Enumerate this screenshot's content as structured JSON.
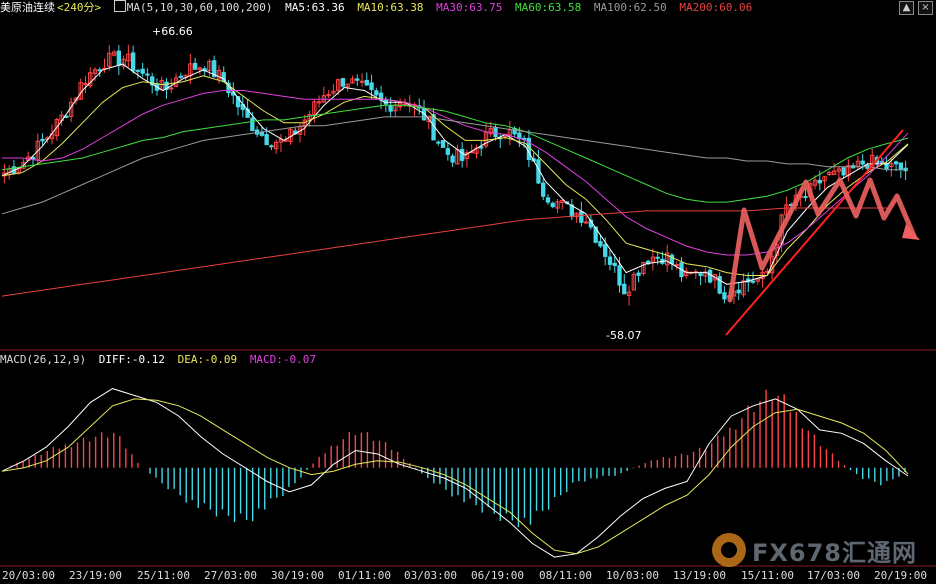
{
  "header": {
    "title": "美原油连续",
    "period": "<240分>",
    "ma_label": "MA(5,10,30,60,100,200)",
    "ma_values": [
      {
        "text": "MA5:63.36",
        "color": "#ffffff"
      },
      {
        "text": "MA10:63.38",
        "color": "#e8e85a"
      },
      {
        "text": "MA30:63.75",
        "color": "#e040e0"
      },
      {
        "text": "MA60:63.58",
        "color": "#40e040"
      },
      {
        "text": "MA100:62.50",
        "color": "#9a9a9a"
      },
      {
        "text": "MA200:60.06",
        "color": "#e84040"
      }
    ],
    "controls": {
      "up": "▲",
      "close": "×"
    }
  },
  "macd_header": {
    "label": "MACD(26,12,9)",
    "diff": "DIFF:-0.12",
    "dea": "DEA:-0.09",
    "macd": "MACD:-0.07"
  },
  "annotations": {
    "high": "+66.66",
    "low": "-58.07"
  },
  "x_axis_labels": [
    "20/03:00",
    "23/19:00",
    "25/11:00",
    "27/03:00",
    "30/19:00",
    "01/11:00",
    "03/03:00",
    "06/19:00",
    "08/11:00",
    "10/03:00",
    "13/19:00",
    "15/11:00",
    "17/03:00",
    "20/19:00"
  ],
  "watermark": {
    "text": "FX678汇通网"
  },
  "colors": {
    "up": "#ff4444",
    "down": "#44d8e8",
    "ma5": "#ffffff",
    "ma10": "#e8e85a",
    "ma30": "#e040e0",
    "ma60": "#40e040",
    "ma100": "#9a9a9a",
    "ma200": "#e84040",
    "diff": "#ffffff",
    "dea": "#e8e85a",
    "arrow": "#f06060"
  },
  "chart_data": [
    {
      "type": "candlestick",
      "title": "美原油连续 <240分>",
      "ylim": [
        56.5,
        67.6
      ],
      "x": [
        "20/03:00",
        "23/19:00",
        "25/11:00",
        "27/03:00",
        "30/19:00",
        "01/11:00",
        "03/03:00",
        "06/19:00",
        "08/11:00",
        "10/03:00",
        "13/19:00",
        "15/11:00",
        "17/03:00",
        "20/19:00"
      ],
      "close_path": [
        62.4,
        62.8,
        63.5,
        64.4,
        65.6,
        66.2,
        66.3,
        65.7,
        65.2,
        65.9,
        66.1,
        65.5,
        64.3,
        63.6,
        63.4,
        64.2,
        65.1,
        65.6,
        65.2,
        64.7,
        64.9,
        64.3,
        63.1,
        62.8,
        63.6,
        63.9,
        63.3,
        61.7,
        61.2,
        60.9,
        59.7,
        58.4,
        59.5,
        59.6,
        58.8,
        59.1,
        58.3,
        58.7,
        58.8,
        61.2,
        61.6,
        62.3,
        62.3,
        62.8,
        62.6,
        62.5
      ],
      "high_label": 66.66,
      "low_label": 58.07,
      "ma": {
        "MA5": {
          "last": 63.36,
          "path": [
            62.3,
            62.6,
            63.3,
            64.2,
            65.2,
            65.9,
            66.1,
            65.6,
            65.2,
            65.6,
            65.9,
            65.6,
            64.7,
            63.9,
            63.5,
            63.9,
            64.7,
            65.3,
            65.2,
            64.8,
            64.8,
            64.4,
            63.5,
            63.0,
            63.4,
            63.7,
            63.3,
            62.1,
            61.4,
            61.0,
            60.0,
            59.0,
            59.3,
            59.4,
            59.0,
            59.0,
            58.6,
            58.7,
            58.9,
            60.4,
            61.2,
            61.9,
            62.3,
            62.7,
            62.7,
            63.36
          ]
        },
        "MA10": {
          "last": 63.38,
          "path": [
            62.3,
            62.4,
            62.8,
            63.4,
            64.1,
            64.8,
            65.3,
            65.5,
            65.4,
            65.5,
            65.7,
            65.5,
            65.0,
            64.5,
            64.1,
            64.1,
            64.4,
            64.8,
            65.0,
            64.9,
            64.8,
            64.6,
            64.0,
            63.5,
            63.5,
            63.6,
            63.4,
            62.7,
            62.0,
            61.5,
            60.8,
            60.0,
            59.8,
            59.6,
            59.3,
            59.2,
            59.0,
            58.9,
            58.9,
            59.8,
            60.5,
            61.3,
            61.9,
            62.4,
            62.8,
            63.38
          ]
        },
        "MA30": {
          "last": 63.75,
          "path": [
            62.9,
            62.9,
            62.8,
            62.9,
            63.2,
            63.6,
            64.0,
            64.4,
            64.7,
            64.9,
            65.1,
            65.2,
            65.2,
            65.1,
            65.0,
            64.9,
            64.9,
            64.9,
            64.9,
            64.9,
            64.8,
            64.6,
            64.3,
            64.0,
            63.8,
            63.7,
            63.5,
            63.1,
            62.6,
            62.1,
            61.5,
            60.9,
            60.5,
            60.2,
            59.9,
            59.7,
            59.6,
            59.6,
            59.7,
            60.0,
            60.5,
            61.1,
            61.7,
            62.3,
            63.0,
            63.75
          ]
        },
        "MA60": {
          "last": 63.58,
          "path": [
            62.5,
            62.6,
            62.7,
            62.8,
            62.9,
            63.1,
            63.3,
            63.5,
            63.6,
            63.8,
            63.9,
            64.0,
            64.1,
            64.2,
            64.2,
            64.3,
            64.4,
            64.5,
            64.6,
            64.7,
            64.7,
            64.6,
            64.5,
            64.3,
            64.1,
            64.0,
            63.8,
            63.5,
            63.2,
            62.9,
            62.6,
            62.3,
            62.0,
            61.7,
            61.5,
            61.4,
            61.4,
            61.5,
            61.6,
            61.8,
            62.1,
            62.5,
            62.9,
            63.2,
            63.4,
            63.58
          ]
        },
        "MA100": {
          "last": 62.5,
          "path": [
            61.0,
            61.2,
            61.4,
            61.7,
            62.0,
            62.3,
            62.6,
            62.9,
            63.1,
            63.3,
            63.5,
            63.6,
            63.7,
            63.8,
            63.9,
            64.0,
            64.0,
            64.1,
            64.2,
            64.3,
            64.3,
            64.3,
            64.2,
            64.1,
            64.0,
            63.9,
            63.8,
            63.7,
            63.6,
            63.5,
            63.4,
            63.3,
            63.2,
            63.1,
            63.0,
            62.9,
            62.9,
            62.8,
            62.8,
            62.7,
            62.7,
            62.6,
            62.6,
            62.6,
            62.5,
            62.5
          ]
        },
        "MA200": {
          "last": 60.06,
          "path": [
            58.2,
            58.3,
            58.4,
            58.5,
            58.6,
            58.7,
            58.8,
            58.9,
            59.0,
            59.1,
            59.2,
            59.3,
            59.4,
            59.5,
            59.6,
            59.7,
            59.8,
            59.9,
            60.0,
            60.1,
            60.2,
            60.3,
            60.4,
            60.5,
            60.6,
            60.7,
            60.8,
            60.85,
            60.9,
            60.95,
            61.0,
            61.05,
            61.1,
            61.1,
            61.1,
            61.1,
            61.1,
            61.1,
            61.15,
            61.2,
            61.2,
            61.2,
            61.2,
            61.2,
            61.2,
            60.06
          ]
        }
      }
    },
    {
      "type": "bar",
      "title": "MACD(26,12,9)",
      "ylim": [
        -1.4,
        1.45
      ],
      "series": [
        {
          "name": "DIFF",
          "last": -0.12,
          "values": [
            -0.05,
            0.1,
            0.3,
            0.6,
            0.95,
            1.15,
            1.05,
            0.95,
            0.75,
            0.45,
            0.2,
            0.0,
            -0.2,
            -0.35,
            -0.25,
            0.05,
            0.25,
            0.2,
            0.05,
            -0.05,
            -0.15,
            -0.3,
            -0.55,
            -0.8,
            -1.1,
            -1.3,
            -1.25,
            -1.0,
            -0.7,
            -0.45,
            -0.3,
            -0.2,
            0.35,
            0.75,
            0.9,
            1.0,
            0.85,
            0.55,
            0.5,
            0.35,
            0.1,
            -0.12
          ]
        },
        {
          "name": "DEA",
          "last": -0.09,
          "values": [
            -0.05,
            0.0,
            0.1,
            0.3,
            0.6,
            0.9,
            1.0,
            0.98,
            0.9,
            0.75,
            0.55,
            0.35,
            0.15,
            0.0,
            -0.1,
            -0.05,
            0.05,
            0.1,
            0.08,
            0.0,
            -0.1,
            -0.25,
            -0.45,
            -0.65,
            -0.95,
            -1.2,
            -1.25,
            -1.15,
            -0.95,
            -0.75,
            -0.55,
            -0.4,
            -0.1,
            0.3,
            0.6,
            0.8,
            0.85,
            0.75,
            0.65,
            0.5,
            0.25,
            -0.09
          ]
        },
        {
          "name": "MACD",
          "last": -0.07,
          "values": [
            0.0,
            0.12,
            0.25,
            0.35,
            0.45,
            0.5,
            0.1,
            -0.2,
            -0.4,
            -0.6,
            -0.7,
            -0.75,
            -0.55,
            -0.3,
            0.05,
            0.35,
            0.55,
            0.4,
            0.2,
            -0.1,
            -0.3,
            -0.5,
            -0.65,
            -0.75,
            -0.8,
            -0.5,
            -0.2,
            -0.15,
            -0.1,
            0.05,
            0.15,
            0.2,
            0.3,
            0.55,
            0.9,
            1.1,
            0.8,
            0.4,
            0.1,
            -0.15,
            -0.25,
            -0.07
          ]
        }
      ]
    }
  ]
}
